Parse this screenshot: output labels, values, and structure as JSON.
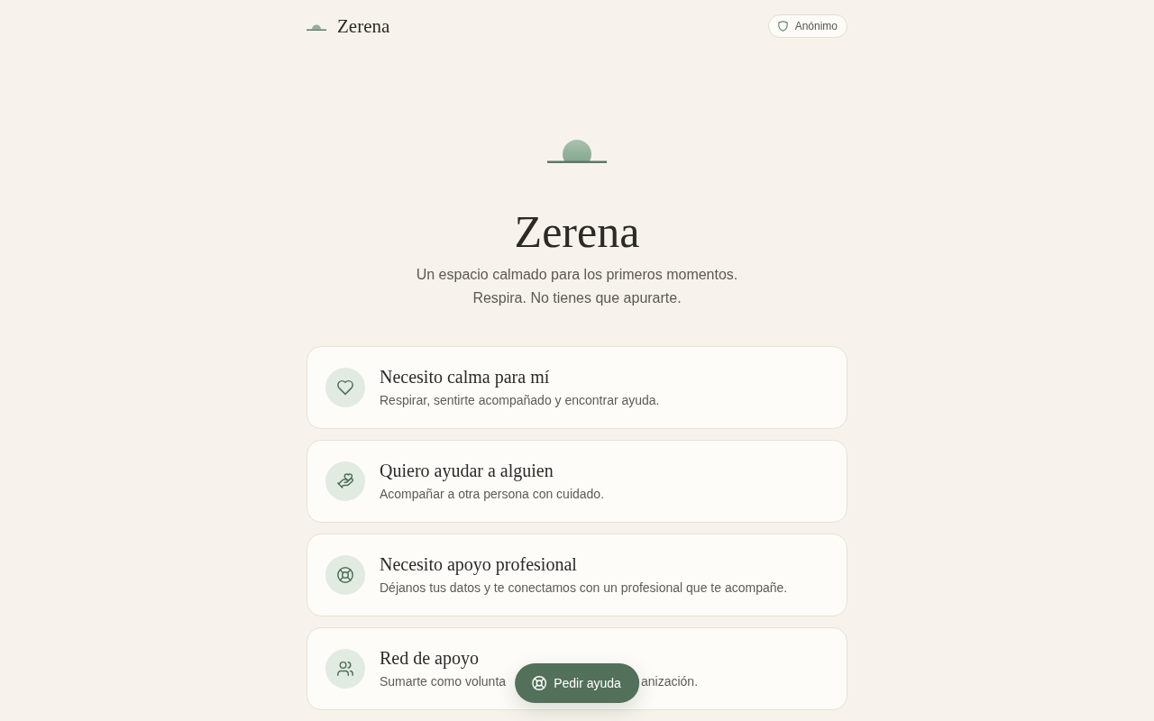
{
  "header": {
    "brand": "Zerena",
    "badge": "Anónimo"
  },
  "hero": {
    "title": "Zerena",
    "subtitle_lines": [
      "Un espacio calmado para los primeros momentos.",
      "Respira. No tienes que apurarte."
    ]
  },
  "options": [
    {
      "title": "Necesito calma para mí",
      "description": "Respirar, sentirte acompañado y encontrar ayuda."
    },
    {
      "title": "Quiero ayudar a alguien",
      "description": "Acompañar a otra persona con cuidado."
    },
    {
      "title": "Necesito apoyo profesional",
      "description": "Déjanos tus datos y te conectamos con un profesional que te acompañe."
    },
    {
      "title": "Red de apoyo",
      "description": "Sumarte como volunta",
      "description_tail": "anización."
    }
  ],
  "help_button": {
    "label": "Pedir ayuda"
  }
}
